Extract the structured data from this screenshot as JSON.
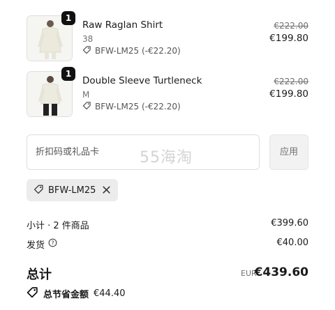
{
  "items": [
    {
      "quantity": "1",
      "name": "Raw Raglan Shirt",
      "variant": "38",
      "discount": "BFW-LM25 (-€22.20)",
      "original_price": "€222.00",
      "price": "€199.80"
    },
    {
      "quantity": "1",
      "name": "Double Sleeve Turtleneck",
      "variant": "M",
      "discount": "BFW-LM25 (-€22.20)",
      "original_price": "€222.00",
      "price": "€199.80"
    }
  ],
  "discount_input": {
    "placeholder": "折扣码或礼品卡"
  },
  "watermark": "55海淘",
  "apply_button": "应用",
  "applied_code": "BFW-LM25",
  "summary": {
    "subtotal_label": "小计 · 2 件商品",
    "subtotal_value": "€399.60",
    "shipping_label": "发货",
    "shipping_value": "€40.00",
    "total_label": "总计",
    "currency": "EUR",
    "total_value": "€439.60",
    "savings_label": "总节省金额",
    "savings_value": "€44.40"
  }
}
